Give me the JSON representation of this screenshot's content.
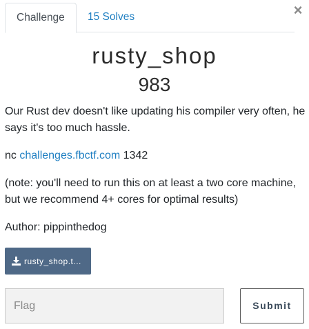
{
  "tabs": {
    "challenge": "Challenge",
    "solves": "15 Solves"
  },
  "close": {
    "icon": "close-icon",
    "glyph": "×"
  },
  "challenge": {
    "name": "rusty_shop",
    "points": "983",
    "description_1": "Our Rust dev doesn't like updating his compiler very often, he says it's too much hassle.",
    "nc_prefix": "nc ",
    "nc_host": "challenges.fbctf.com",
    "nc_port": " 1342",
    "description_3": "(note: you'll need to run this on at least a two core machine, but we recommend 4+ cores for optimal results)",
    "author": "Author: pippinthedog"
  },
  "download": {
    "icon": "download-icon",
    "label": "rusty_shop.t..."
  },
  "submission": {
    "placeholder": "Flag",
    "submit_label": "Submit"
  },
  "colors": {
    "link": "#1f7fc2",
    "download_bg": "#4f6987",
    "input_bg": "#f2f2f2"
  }
}
